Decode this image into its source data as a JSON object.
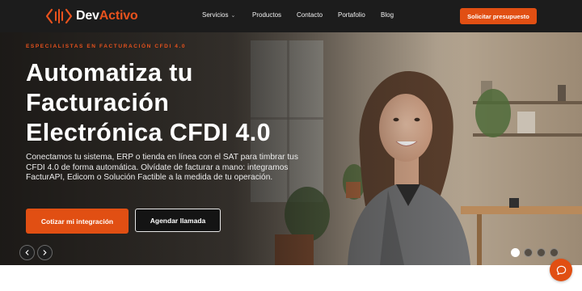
{
  "brand": {
    "name_prefix": "Dev",
    "name_suffix": "Activo",
    "accent_color": "#e8521d",
    "logo_icon": "code-brackets-icon"
  },
  "nav": {
    "items": [
      {
        "label": "Servicios",
        "has_dropdown": true
      },
      {
        "label": "Productos"
      },
      {
        "label": "Contacto"
      },
      {
        "label": "Portafolio"
      },
      {
        "label": "Blog"
      }
    ],
    "dropdown_icon": "chevron-down-icon",
    "cta_label": "Solicitar presupuesto"
  },
  "hero": {
    "eyebrow": "ESPECIALISTAS EN FACTURACIÓN CFDI 4.0",
    "headline_lines": [
      "Automatiza tu",
      "Facturación",
      "Electrónica CFDI 4.0"
    ],
    "subcopy": "Conectamos tu sistema, ERP o tienda en línea con el SAT para timbrar tus CFDI 4.0 de forma automática. Olvídate de facturar a mano: integramos FacturAPI, Edicom o Solución Factible a la medida de tu operación.",
    "primary_cta": "Cotizar mi integración",
    "secondary_cta": "Agendar llamada",
    "image": "smiling-woman-in-office-photo",
    "prev_icon": "chevron-left-icon",
    "next_icon": "chevron-right-icon",
    "slides_total": 4,
    "active_slide": 1
  },
  "chat": {
    "icon": "chat-bubble-icon"
  }
}
